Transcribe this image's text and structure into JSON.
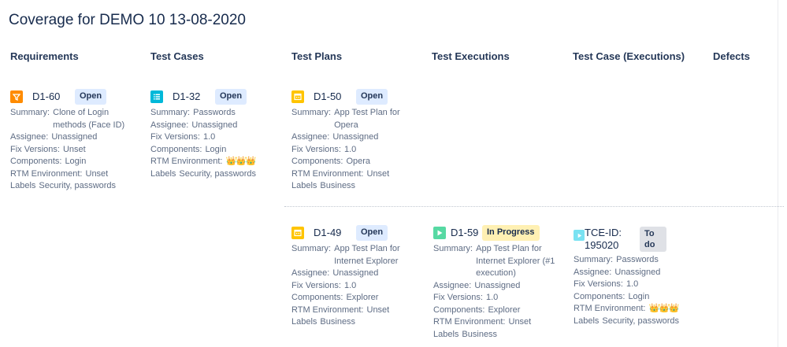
{
  "page": {
    "title": "Coverage for DEMO 10 13-08-2020"
  },
  "columns": [
    "Requirements",
    "Test Cases",
    "Test Plans",
    "Test Executions",
    "Test Case (Executions)",
    "Defects"
  ],
  "labels": {
    "summary": "Summary:",
    "assignee": "Assignee:",
    "fix_versions": "Fix Versions:",
    "components": "Components:",
    "rtm_environment": "RTM Environment:",
    "labels": "Labels"
  },
  "colors": {
    "requirement_icon": "#ff8b00",
    "test_case_icon": "#00b8d9",
    "test_plan_icon": "#ffc400",
    "test_execution_icon": "#57d9a3",
    "tce_icon": "#79e2f2"
  },
  "cards": {
    "req_d1_60": {
      "icon": "requirement-icon",
      "key": "D1-60",
      "status": "Open",
      "summary": "Clone of Login methods (Face ID)",
      "assignee": "Unassigned",
      "fix_versions": "Unset",
      "components": "Login",
      "rtm_environment": "Unset",
      "labels": "Security, passwords"
    },
    "tc_d1_32": {
      "icon": "test-case-icon",
      "key": "D1-32",
      "status": "Open",
      "summary": "Passwords",
      "assignee": "Unassigned",
      "fix_versions": "1.0",
      "components": "Login",
      "rtm_environment": "👑👑👑",
      "labels": "Security, passwords"
    },
    "tp_d1_50": {
      "icon": "test-plan-icon",
      "key": "D1-50",
      "status": "Open",
      "summary": "App Test Plan for Opera",
      "assignee": "Unassigned",
      "fix_versions": "1.0",
      "components": "Opera",
      "rtm_environment": "Unset",
      "labels": "Business"
    },
    "tp_d1_49": {
      "icon": "test-plan-icon",
      "key": "D1-49",
      "status": "Open",
      "summary": "App Test Plan for Internet Explorer",
      "assignee": "Unassigned",
      "fix_versions": "1.0",
      "components": "Explorer",
      "rtm_environment": "Unset",
      "labels": "Business"
    },
    "te_d1_59": {
      "icon": "test-execution-icon",
      "key": "D1-59",
      "status": "In Progress",
      "summary": "App Test Plan for Internet Explorer (#1 execution)",
      "assignee": "Unassigned",
      "fix_versions": "1.0",
      "components": "Explorer",
      "rtm_environment": "Unset",
      "labels": "Business"
    },
    "tce_195020": {
      "icon": "tce-icon",
      "key": "TCE-ID: 195020",
      "status": "To do",
      "summary": "Passwords",
      "assignee": "Unassigned",
      "fix_versions": "1.0",
      "components": "Login",
      "rtm_environment": "👑👑👑",
      "labels": "Security, passwords"
    }
  }
}
